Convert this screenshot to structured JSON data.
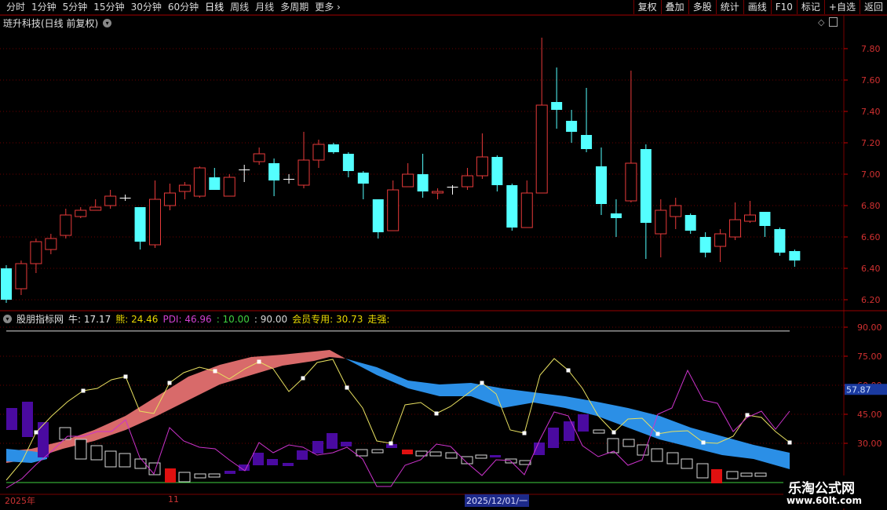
{
  "toolbar": {
    "periods": [
      "分时",
      "1分钟",
      "5分钟",
      "15分钟",
      "30分钟",
      "60分钟",
      "日线",
      "周线",
      "月线",
      "多周期",
      "更多"
    ],
    "actions": [
      "复权",
      "叠加",
      "多股",
      "统计",
      "画线",
      "F10",
      "标记",
      "+自选",
      "返回"
    ]
  },
  "main_chart": {
    "title": "琏升科技(日线 前复权)",
    "ticks": [
      "7.80",
      "7.60",
      "7.40",
      "7.20",
      "7.00",
      "6.80",
      "6.60",
      "6.40",
      "6.20"
    ]
  },
  "indicator": {
    "source": "股朋指标网",
    "items": [
      {
        "label": "牛: 17.17",
        "color": "#e8e8e8"
      },
      {
        "label": "熊: 24.46",
        "color": "#e8d800"
      },
      {
        "label": "PDI: 46.96",
        "color": "#d040d0"
      },
      {
        "label": ": 10.00",
        "color": "#40d040"
      },
      {
        "label": ": 90.00",
        "color": "#d8d8d8"
      },
      {
        "label": "会员专用: 30.73",
        "color": "#e8d800"
      },
      {
        "label": "走强:",
        "color": "#e8d800"
      }
    ],
    "ticks": [
      "90.00",
      "75.00",
      "60.00",
      "45.00",
      "30.00"
    ],
    "current_value": "57.87"
  },
  "dates": {
    "start": "2025年",
    "mid": "11",
    "selected": "2025/12/01/一"
  },
  "watermark": {
    "line1": "乐淘公式网",
    "line2": "www.60lt.com"
  },
  "chart_data": {
    "type": "candlestick",
    "ylim": [
      6.13,
      7.93
    ],
    "candles": [
      [
        6.4,
        6.2,
        6.42,
        6.18
      ],
      [
        6.27,
        6.43,
        6.45,
        6.23
      ],
      [
        6.43,
        6.57,
        6.59,
        6.37
      ],
      [
        6.52,
        6.59,
        6.62,
        6.49
      ],
      [
        6.61,
        6.74,
        6.78,
        6.59
      ],
      [
        6.73,
        6.77,
        6.79,
        6.72
      ],
      [
        6.77,
        6.79,
        6.84,
        6.77
      ],
      [
        6.8,
        6.86,
        6.9,
        6.78
      ],
      [
        6.85,
        6.85,
        6.87,
        6.83
      ],
      [
        6.79,
        6.57,
        6.79,
        6.52
      ],
      [
        6.55,
        6.84,
        6.96,
        6.53
      ],
      [
        6.8,
        6.88,
        6.94,
        6.77
      ],
      [
        6.89,
        6.93,
        6.95,
        6.84
      ],
      [
        6.86,
        7.04,
        7.05,
        6.85
      ],
      [
        6.98,
        6.9,
        7.04,
        6.9
      ],
      [
        6.86,
        6.98,
        7.0,
        6.86
      ],
      [
        7.03,
        7.03,
        7.06,
        6.95
      ],
      [
        7.08,
        7.13,
        7.17,
        7.06
      ],
      [
        7.07,
        6.96,
        7.1,
        6.86
      ],
      [
        6.97,
        6.97,
        7.0,
        6.94
      ],
      [
        6.93,
        7.09,
        7.27,
        6.91
      ],
      [
        7.09,
        7.19,
        7.22,
        7.04
      ],
      [
        7.19,
        7.14,
        7.2,
        7.13
      ],
      [
        7.13,
        7.02,
        7.14,
        6.98
      ],
      [
        7.01,
        6.94,
        7.02,
        6.84
      ],
      [
        6.84,
        6.63,
        6.84,
        6.59
      ],
      [
        6.64,
        6.9,
        6.96,
        6.64
      ],
      [
        6.92,
        7.0,
        7.07,
        6.92
      ],
      [
        7.0,
        6.89,
        7.13,
        6.85
      ],
      [
        6.88,
        6.89,
        6.91,
        6.84
      ],
      [
        6.92,
        6.92,
        6.93,
        6.87
      ],
      [
        6.92,
        6.99,
        7.04,
        6.9
      ],
      [
        6.99,
        7.11,
        7.26,
        6.97
      ],
      [
        7.11,
        6.93,
        7.12,
        6.89
      ],
      [
        6.93,
        6.66,
        6.94,
        6.64
      ],
      [
        6.66,
        6.88,
        6.96,
        6.66
      ],
      [
        6.88,
        7.44,
        7.87,
        6.88
      ],
      [
        7.46,
        7.41,
        7.68,
        7.29
      ],
      [
        7.34,
        7.27,
        7.41,
        7.2
      ],
      [
        7.25,
        7.16,
        7.55,
        7.14
      ],
      [
        7.05,
        6.81,
        7.17,
        6.74
      ],
      [
        6.75,
        6.72,
        6.84,
        6.6
      ],
      [
        6.83,
        7.07,
        7.66,
        6.82
      ],
      [
        7.16,
        6.69,
        7.19,
        6.46
      ],
      [
        6.62,
        6.77,
        6.84,
        6.47
      ],
      [
        6.73,
        6.8,
        6.85,
        6.65
      ],
      [
        6.74,
        6.64,
        6.75,
        6.62
      ],
      [
        6.6,
        6.5,
        6.63,
        6.47
      ],
      [
        6.54,
        6.62,
        6.65,
        6.44
      ],
      [
        6.6,
        6.71,
        6.82,
        6.58
      ],
      [
        6.7,
        6.74,
        6.83,
        6.69
      ],
      [
        6.76,
        6.67,
        6.76,
        6.6
      ],
      [
        6.65,
        6.5,
        6.66,
        6.48
      ],
      [
        6.51,
        6.45,
        6.52,
        6.41
      ]
    ],
    "series": [
      {
        "name": "牛",
        "color": "#ffffff",
        "values": []
      },
      {
        "name": "熊",
        "color": "#e8d800",
        "values": []
      },
      {
        "name": "PDI",
        "color": "#d040d0",
        "values": []
      }
    ]
  }
}
